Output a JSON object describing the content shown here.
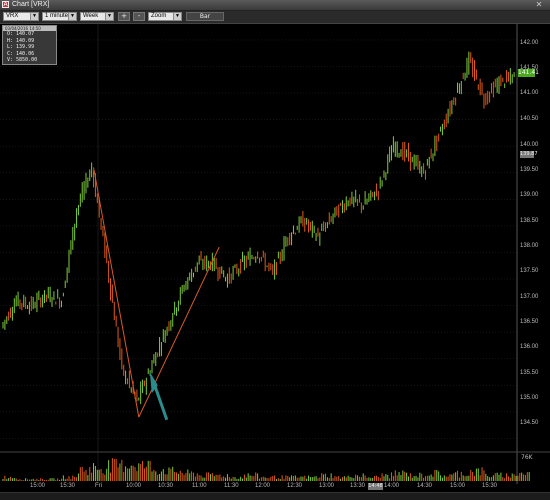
{
  "window": {
    "title": "Chart [VRX]",
    "close_glyph": "✕",
    "app_icon": "A"
  },
  "toolbar": {
    "symbol": "VRX",
    "interval": "1 minute",
    "range": "Week",
    "zoom_in": "+",
    "zoom_out": "-",
    "zoom": "Zoom",
    "style_button": "Bar"
  },
  "ohlc": {
    "header": "03/04/2016 14:50",
    "open": "O: 140.07",
    "high": "H: 140.09",
    "low": "L: 139.99",
    "close": "C: 140.06",
    "volume": "V: 5850.00"
  },
  "price_axis": {
    "ticks": [
      "142.00",
      "141.50",
      "141.00",
      "140.50",
      "140.00",
      "139.50",
      "139.00",
      "138.50",
      "138.00",
      "137.50",
      "137.00",
      "136.50",
      "136.00",
      "135.50",
      "135.00",
      "134.50"
    ],
    "last_price": "141.41",
    "marker_price": "139.87"
  },
  "time_axis": {
    "ticks": [
      "15:00",
      "15:30",
      "Fri",
      "10:00",
      "10:30",
      "11:00",
      "11:30",
      "12:00",
      "12:30",
      "13:00",
      "13:30",
      "14:00",
      "14:30",
      "15:00",
      "15:30"
    ],
    "date_tag": "14:48"
  },
  "volume_axis": {
    "label": "76K"
  },
  "colors": {
    "up": "#7ecb3c",
    "down": "#e05a1c",
    "annotation": "#d85a2a",
    "arrow": "#2c8c8c",
    "grid": "#2a2a2a",
    "last_price_bg": "#4ca81f"
  },
  "chart_data": {
    "type": "line",
    "title": "Chart [VRX]",
    "xlabel": "",
    "ylabel": "",
    "ylim": [
      134.3,
      142.3
    ],
    "grid": true,
    "series": [
      {
        "name": "VRX",
        "x": [
          "Thu 14:45",
          "Thu 15:00",
          "Thu 15:15",
          "Thu 15:30",
          "Thu 15:45",
          "Fri 09:30",
          "Fri 09:40",
          "Fri 09:48",
          "Fri 09:55",
          "Fri 10:02",
          "Fri 10:08",
          "Fri 10:15",
          "Fri 10:25",
          "Fri 10:40",
          "Fri 10:55",
          "Fri 11:10",
          "Fri 11:25",
          "Fri 11:40",
          "Fri 11:55",
          "Fri 12:10",
          "Fri 12:25",
          "Fri 12:40",
          "Fri 12:55",
          "Fri 13:10",
          "Fri 13:25",
          "Fri 13:40",
          "Fri 13:55",
          "Fri 14:10",
          "Fri 14:20",
          "Fri 14:30",
          "Fri 14:45",
          "Fri 15:00",
          "Fri 15:15",
          "Fri 15:30",
          "Fri 15:45"
        ],
        "values": [
          136.6,
          137.1,
          137.0,
          137.2,
          137.1,
          138.8,
          139.6,
          137.8,
          135.8,
          135.2,
          135.9,
          136.6,
          137.3,
          137.8,
          137.8,
          137.5,
          137.8,
          138.0,
          137.6,
          138.3,
          138.6,
          138.3,
          138.7,
          139.0,
          138.9,
          139.2,
          140.0,
          139.8,
          139.5,
          140.2,
          140.9,
          141.6,
          140.9,
          141.2,
          141.3
        ]
      }
    ],
    "volume": [
      2,
      1,
      1,
      1,
      2,
      6,
      7,
      8,
      9,
      8,
      6,
      5,
      4,
      3,
      3,
      2,
      3,
      2,
      2,
      2,
      2,
      3,
      2,
      3,
      2,
      3,
      4,
      3,
      4,
      3,
      4,
      5,
      3,
      3,
      4
    ]
  }
}
